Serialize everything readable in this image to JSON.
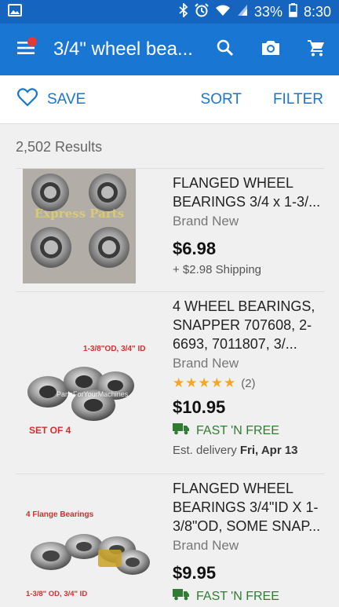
{
  "status": {
    "battery": "33%",
    "time": "8:30"
  },
  "app_bar": {
    "title": "3/4\" wheel bea..."
  },
  "actions": {
    "save": "SAVE",
    "sort": "SORT",
    "filter": "FILTER"
  },
  "results_count": "2,502 Results",
  "items": [
    {
      "title": "FLANGED WHEEL BEARINGS 3/4 x 1-3/...",
      "condition": "Brand New",
      "price": "$6.98",
      "shipping": "+ $2.98 Shipping",
      "image_text": [
        "Express Parts"
      ]
    },
    {
      "title": "4 WHEEL BEARINGS, SNAPPER 707608, 2-6693, 7011807, 3/...",
      "condition": "Brand New",
      "stars": "★★★★★",
      "rating_count": "(2)",
      "price": "$10.95",
      "fast_label": "FAST 'N FREE",
      "delivery_prefix": "Est. delivery ",
      "delivery_date": "Fri, Apr 13",
      "image_text": [
        "1-3/8\"OD, 3/4\" ID",
        "SET OF 4",
        "PartsForYourMachines"
      ]
    },
    {
      "title": "FLANGED WHEEL BEARINGS 3/4\"ID X 1-3/8\"OD, SOME SNAP...",
      "condition": "Brand New",
      "price": "$9.95",
      "fast_label": "FAST 'N FREE",
      "image_text": [
        "4 Flange Bearings",
        "1-3/8\" OD, 3/4\" ID"
      ]
    }
  ],
  "colors": {
    "primary": "#1976d2",
    "status_bar": "#1565c0",
    "fast": "#2e7d32",
    "star": "#f5a623",
    "badge": "#e53935"
  },
  "icons": [
    "image-icon",
    "bluetooth-icon",
    "alarm-icon",
    "wifi-icon",
    "signal-icon",
    "battery-icon",
    "menu-icon",
    "search-icon",
    "camera-icon",
    "cart-icon",
    "heart-outline-icon",
    "truck-icon"
  ]
}
